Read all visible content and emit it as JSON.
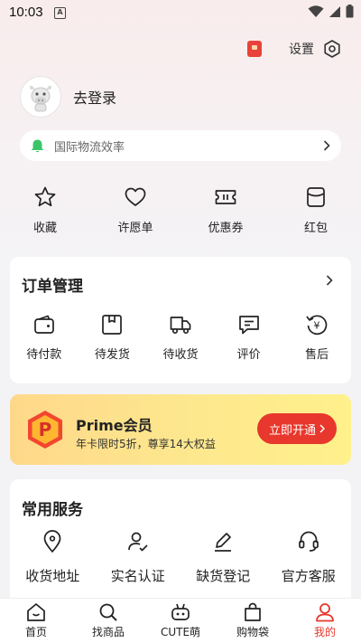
{
  "status_bar": {
    "time": "10:03",
    "notification_glyph": "A"
  },
  "header": {
    "settings_label": "设置",
    "gift_icon": "red-envelope-icon"
  },
  "profile": {
    "login_label": "去登录",
    "avatar_icon": "cow-mascot-avatar"
  },
  "notice": {
    "text": "国际物流效率"
  },
  "quick_links": [
    {
      "label": "收藏",
      "icon": "star-icon"
    },
    {
      "label": "许愿单",
      "icon": "heart-icon"
    },
    {
      "label": "优惠券",
      "icon": "ticket-icon"
    },
    {
      "label": "红包",
      "icon": "red-packet-icon"
    }
  ],
  "orders": {
    "title": "订单管理",
    "items": [
      {
        "label": "待付款",
        "icon": "wallet-icon"
      },
      {
        "label": "待发货",
        "icon": "box-icon"
      },
      {
        "label": "待收货",
        "icon": "truck-icon"
      },
      {
        "label": "评价",
        "icon": "comment-icon"
      },
      {
        "label": "售后",
        "icon": "refund-icon"
      }
    ]
  },
  "prime": {
    "badge": "P",
    "title": "Prime会员",
    "subtitle": "年卡限时5折，尊享14大权益",
    "button_label": "立即开通",
    "accent": "#e8372c"
  },
  "services": {
    "title": "常用服务",
    "items": [
      {
        "label": "收货地址",
        "icon": "location-icon"
      },
      {
        "label": "实名认证",
        "icon": "user-check-icon"
      },
      {
        "label": "缺货登记",
        "icon": "pencil-icon"
      },
      {
        "label": "官方客服",
        "icon": "headset-icon"
      }
    ]
  },
  "tabs": [
    {
      "label": "首页",
      "icon": "home-icon",
      "active": false
    },
    {
      "label": "找商品",
      "icon": "search-icon",
      "active": false
    },
    {
      "label": "CUTE萌",
      "icon": "cute-robot-icon",
      "active": false
    },
    {
      "label": "购物袋",
      "icon": "shopping-bag-icon",
      "active": false
    },
    {
      "label": "我的",
      "icon": "profile-icon",
      "active": true
    }
  ]
}
